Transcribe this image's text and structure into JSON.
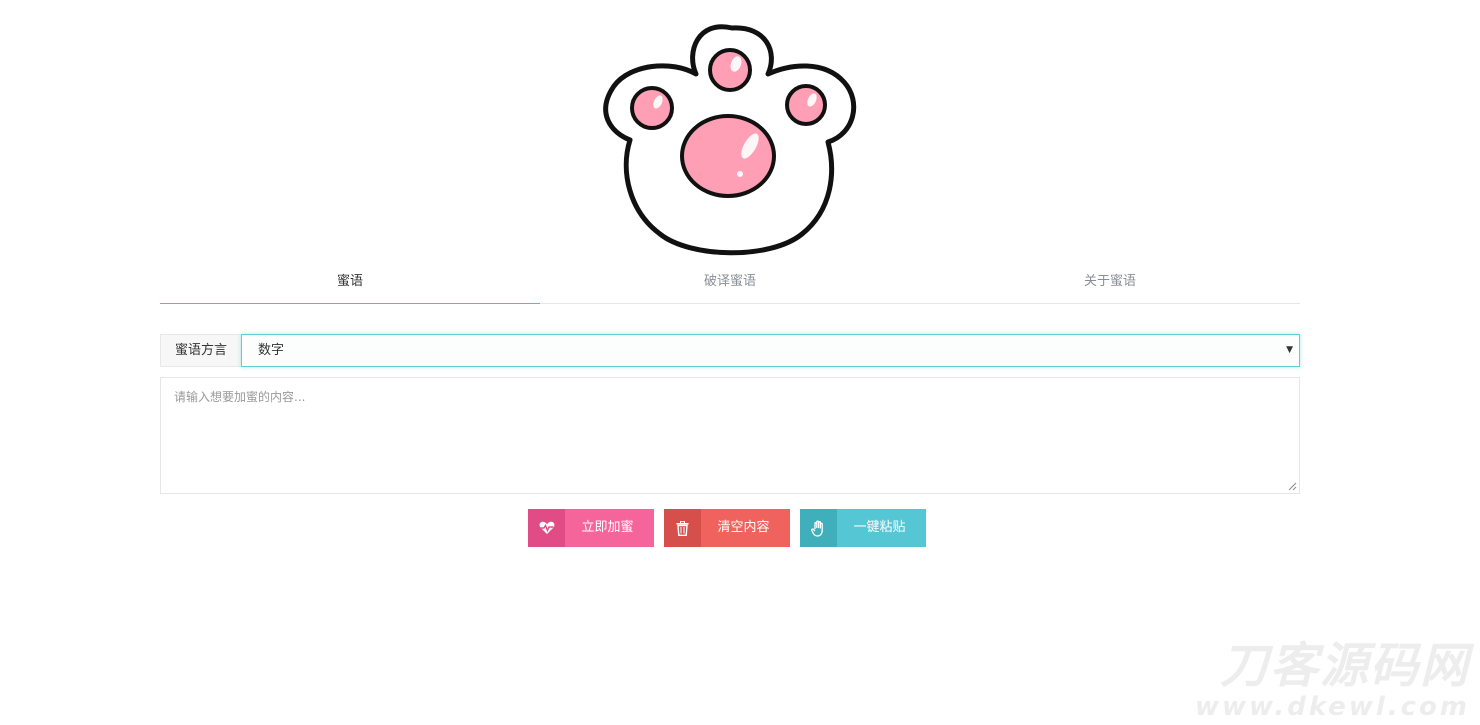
{
  "tabs": [
    {
      "label": "蜜语",
      "active": true
    },
    {
      "label": "破译蜜语",
      "active": false
    },
    {
      "label": "关于蜜语",
      "active": false
    }
  ],
  "form": {
    "dialect_label": "蜜语方言",
    "dialect_selected": "数字",
    "text_placeholder": "请输入想要加蜜的内容..."
  },
  "buttons": {
    "encrypt": {
      "label": "立即加蜜",
      "icon": "heartbeat-icon",
      "color": "#f5649b"
    },
    "clear": {
      "label": "清空内容",
      "icon": "trash-icon",
      "color": "#f0625d"
    },
    "paste": {
      "label": "一键粘贴",
      "icon": "hand-icon",
      "color": "#55c6d3"
    }
  },
  "accent_color": "#44c2c8",
  "logo": {
    "icon": "cat-paw-icon",
    "pad_color": "#ff9fb5"
  },
  "watermark": {
    "text_cn": "刀客源码网",
    "text_en": "www.dkewl.com"
  }
}
